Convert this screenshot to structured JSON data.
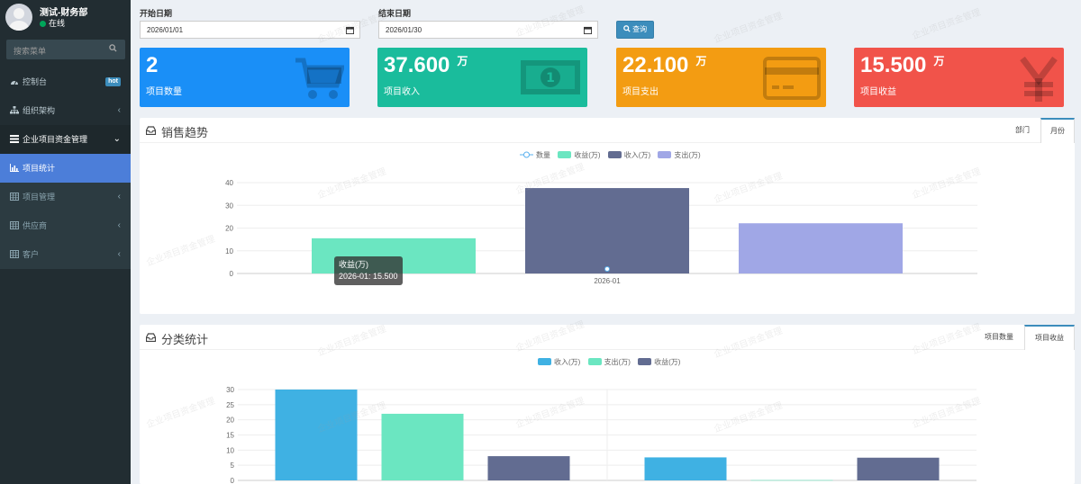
{
  "user": {
    "name": "测试-财务部",
    "status": "在线"
  },
  "sidebar": {
    "search_placeholder": "搜索菜单",
    "items": [
      {
        "label": "控制台",
        "badge": "hot"
      },
      {
        "label": "组织架构"
      },
      {
        "label": "企业项目资金管理"
      },
      {
        "label": "项目统计"
      },
      {
        "label": "项目管理"
      },
      {
        "label": "供应商"
      },
      {
        "label": "客户"
      }
    ]
  },
  "filters": {
    "start_label": "开始日期",
    "start_value": "2026/01/01",
    "end_label": "结束日期",
    "end_value": "2026/01/30",
    "query_label": "查询"
  },
  "stats": [
    {
      "value": "2",
      "unit": "",
      "label": "项目数量",
      "color": "#1a8ff7",
      "icon": "cart-icon"
    },
    {
      "value": "37.600",
      "unit": "万",
      "label": "项目收入",
      "color": "#1abc9c",
      "icon": "money-icon"
    },
    {
      "value": "22.100",
      "unit": "万",
      "label": "项目支出",
      "color": "#f39c12",
      "icon": "credit-card-icon"
    },
    {
      "value": "15.500",
      "unit": "万",
      "label": "项目收益",
      "color": "#f1534a",
      "icon": "yen-icon"
    }
  ],
  "sales_panel": {
    "title": "销售趋势",
    "tabs": [
      "部门",
      "月份"
    ],
    "active_tab": "月份"
  },
  "category_panel": {
    "title": "分类统计",
    "tabs": [
      "项目数量",
      "项目收益"
    ],
    "active_tab": "项目收益"
  },
  "tooltip": {
    "title": "收益(万)",
    "line": "2026-01: 15.500"
  },
  "watermark_text": "企业项目资金管理",
  "chart_data": [
    {
      "type": "bar",
      "categories": [
        "2026-01"
      ],
      "series": [
        {
          "name": "数量",
          "type": "line",
          "values": [
            2
          ],
          "color": "#5ab1ef"
        },
        {
          "name": "收益(万)",
          "values": [
            15.5
          ],
          "color": "#6be6c1"
        },
        {
          "name": "收入(万)",
          "values": [
            37.6
          ],
          "color": "#626c91"
        },
        {
          "name": "支出(万)",
          "values": [
            22.1
          ],
          "color": "#a0a7e6"
        }
      ],
      "ylim": [
        0,
        40
      ],
      "yticks": [
        0,
        10,
        20,
        30,
        40
      ],
      "legend_position": "top-center"
    },
    {
      "type": "bar",
      "categories": [
        "",
        ""
      ],
      "series": [
        {
          "name": "收入(万)",
          "values": [
            30,
            7.6
          ],
          "color": "#3fb1e3"
        },
        {
          "name": "支出(万)",
          "values": [
            22,
            0.1
          ],
          "color": "#6be6c1"
        },
        {
          "name": "收益(万)",
          "values": [
            8,
            7.5
          ],
          "color": "#626c91"
        }
      ],
      "ylim": [
        0,
        30
      ],
      "yticks": [
        0,
        5,
        10,
        15,
        20,
        25,
        30
      ],
      "legend_position": "top-center"
    }
  ]
}
